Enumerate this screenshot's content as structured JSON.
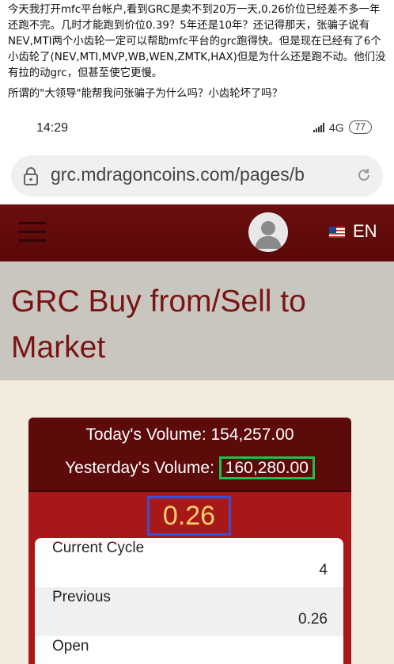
{
  "post": {
    "paragraph1": "今天我打开mfc平台帐户,看到GRC是卖不到20万一天,0.26价位已经差不多一年还跑不完。几时才能跑到价位0.39？5年还是10年？还记得那天，张骗子说有NEV,MTI两个小齿轮一定可以帮助mfc平台的grc跑得快。但是现在已经有了6个小齿轮了(NEV,MTI,MVP,WB,WEN,ZMTK,HAX)但是为什么还是跑不动。他们没有拉的动grc，但甚至使它更慢。",
    "paragraph2": "所谓的\"大领导\"能帮我问张骗子为什么吗？小齿轮坏了吗？"
  },
  "status_bar": {
    "time": "14:29",
    "network": "4G",
    "battery": "77"
  },
  "browser": {
    "url": "grc.mdragoncoins.com/pages/b"
  },
  "header": {
    "language": "EN"
  },
  "page": {
    "title": "GRC Buy from/Sell to Market"
  },
  "volume": {
    "today_label": "Today's Volume:",
    "today_value": "154,257.00",
    "yesterday_label": "Yesterday's Volume:",
    "yesterday_value": "160,280.00"
  },
  "price": "0.26",
  "stats": [
    {
      "label": "Current Cycle",
      "value": "4"
    },
    {
      "label": "Previous",
      "value": "0.26"
    },
    {
      "label": "Open",
      "value": ""
    }
  ],
  "colors": {
    "header_bg": "#5a0808",
    "title_color": "#7a1414",
    "highlight_green": "#19c24a",
    "highlight_blue": "#3a50d0",
    "price_color": "#f6cf70"
  }
}
